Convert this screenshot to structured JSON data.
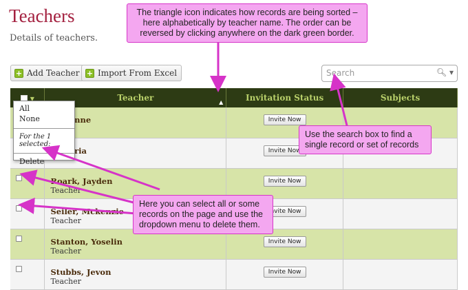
{
  "page": {
    "title": "Teachers",
    "subtitle": "Details of teachers."
  },
  "toolbar": {
    "add_label": "Add Teacher",
    "import_label": "Import From Excel"
  },
  "search": {
    "placeholder": "Search",
    "value": ""
  },
  "table": {
    "headers": {
      "teacher": "Teacher",
      "invitation": "Invitation Status",
      "subjects": "Subjects"
    },
    "sort_indicator": "▲",
    "rows": [
      {
        "name": "Adrienne",
        "role": "",
        "invite": "Invite Now"
      },
      {
        "name": "Macaria",
        "role": "",
        "invite": "Invite Now"
      },
      {
        "name": "Roark, Jayden",
        "role": "Teacher",
        "invite": "Invite Now"
      },
      {
        "name": "Seiler, Mckenzie",
        "role": "Teacher",
        "invite": "Invite Now"
      },
      {
        "name": "Stanton, Yoselin",
        "role": "Teacher",
        "invite": "Invite Now"
      },
      {
        "name": "Stubbs, Jevon",
        "role": "Teacher",
        "invite": "Invite Now"
      }
    ]
  },
  "select_menu": {
    "all": "All",
    "none": "None",
    "for_selected": "For the 1 selected:",
    "delete": "Delete"
  },
  "callouts": {
    "sort": "The triangle icon indicates how records are being sorted – here alphabetically by teacher name. The order can be reversed by clicking anywhere on the dark green border.",
    "search": "Use the search box to find a single record or set of records",
    "select": "Here you can select all or some records on the page and use the dropdown menu to delete them."
  },
  "colors": {
    "header_bg": "#2d3b14",
    "row_green": "#d7e4a8",
    "callout_bg": "#f4a7f0",
    "callout_border": "#d633c8",
    "title": "#a3203f"
  }
}
